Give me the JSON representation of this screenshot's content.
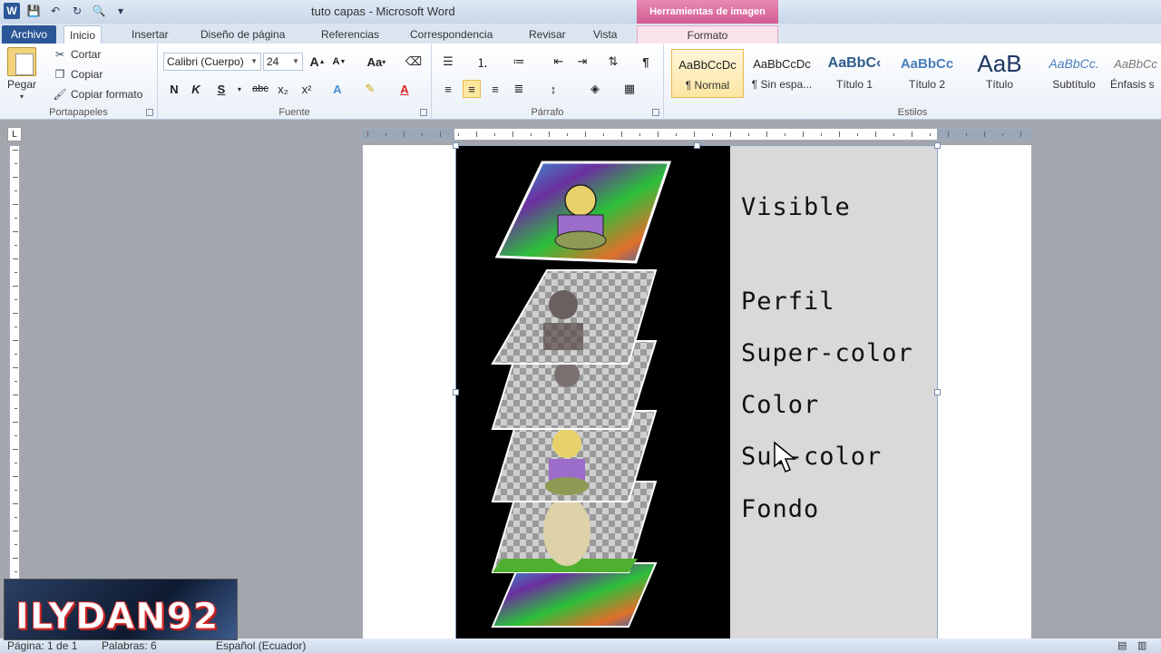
{
  "window": {
    "title": "tuto capas  -  Microsoft Word",
    "context_tab_group": "Herramientas de imagen"
  },
  "tabs": [
    {
      "label": "Archivo"
    },
    {
      "label": "Inicio"
    },
    {
      "label": "Insertar"
    },
    {
      "label": "Diseño de página"
    },
    {
      "label": "Referencias"
    },
    {
      "label": "Correspondencia"
    },
    {
      "label": "Revisar"
    },
    {
      "label": "Vista"
    },
    {
      "label": "Formato"
    }
  ],
  "clipboard": {
    "paste": "Pegar",
    "cut": "Cortar",
    "copy": "Copiar",
    "format_painter": "Copiar formato",
    "label": "Portapapeles"
  },
  "font": {
    "name": "Calibri (Cuerpo)",
    "size": "24",
    "bold": "N",
    "italic": "K",
    "underline": "S",
    "strike": "abc",
    "subscript": "x₂",
    "superscript": "x²",
    "grow": "A",
    "shrink": "A",
    "case": "Aa",
    "label": "Fuente"
  },
  "paragraph": {
    "label": "Párrafo",
    "pilcrow": "¶"
  },
  "styles": {
    "label": "Estilos",
    "items": [
      {
        "preview": "AaBbCcDc",
        "label": "¶ Normal"
      },
      {
        "preview": "AaBbCcDc",
        "label": "¶ Sin espa..."
      },
      {
        "preview": "AaBbC‹",
        "label": "Título 1"
      },
      {
        "preview": "AaBbCc",
        "label": "Título 2"
      },
      {
        "preview": "AaB",
        "label": "Título"
      },
      {
        "preview": "AaBbCc.",
        "label": "Subtítulo"
      },
      {
        "preview": "AaBbCc",
        "label": "Énfasis s"
      }
    ]
  },
  "document": {
    "layers": [
      "Visible",
      "Perfil",
      "Super-color",
      "Color",
      "Sub-color",
      "Fondo"
    ]
  },
  "status": {
    "page": "Página: 1 de 1",
    "words": "Palabras: 6",
    "language": "Español (Ecuador)"
  },
  "watermark": {
    "text": "ILYDAN92"
  },
  "colors": {
    "accent": "#2b5797",
    "context": "#d35b91"
  }
}
